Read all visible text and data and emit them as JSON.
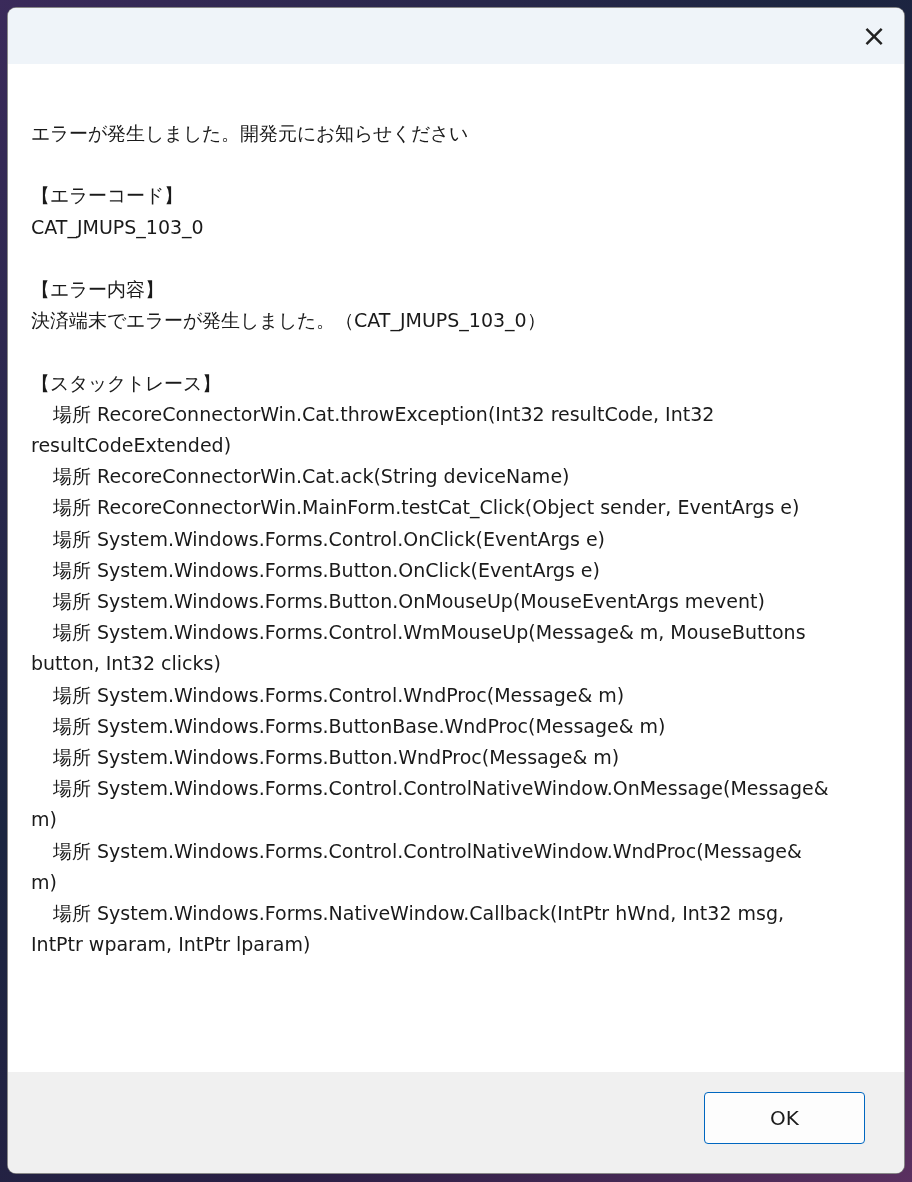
{
  "dialog": {
    "close_button": "×",
    "message": "エラーが発生しました。開発元にお知らせください",
    "sections": [
      {
        "heading": "【エラーコード】",
        "lines": [
          "CAT_JMUPS_103_0"
        ]
      },
      {
        "heading": "【エラー内容】",
        "lines": [
          "決済端末でエラーが発生しました。（CAT_JMUPS_103_0）"
        ]
      },
      {
        "heading": "【スタックトレース】",
        "lines": [
          "場所 RecoreConnectorWin.Cat.throwException(Int32 resultCode, Int32 resultCodeExtended)",
          "場所 RecoreConnectorWin.Cat.ack(String deviceName)",
          "場所 RecoreConnectorWin.MainForm.testCat_Click(Object sender, EventArgs e)",
          "場所 System.Windows.Forms.Control.OnClick(EventArgs e)",
          "場所 System.Windows.Forms.Button.OnClick(EventArgs e)",
          "場所 System.Windows.Forms.Button.OnMouseUp(MouseEventArgs mevent)",
          "場所 System.Windows.Forms.Control.WmMouseUp(Message& m, MouseButtons button, Int32 clicks)",
          "場所 System.Windows.Forms.Control.WndProc(Message& m)",
          "場所 System.Windows.Forms.ButtonBase.WndProc(Message& m)",
          "場所 System.Windows.Forms.Button.WndProc(Message& m)",
          "場所 System.Windows.Forms.Control.ControlNativeWindow.OnMessage(Message& m)",
          "場所 System.Windows.Forms.Control.ControlNativeWindow.WndProc(Message& m)",
          "場所 System.Windows.Forms.NativeWindow.Callback(IntPtr hWnd, Int32 msg, IntPtr wparam, IntPtr lparam)"
        ]
      }
    ],
    "buttons": [
      "OK"
    ]
  }
}
